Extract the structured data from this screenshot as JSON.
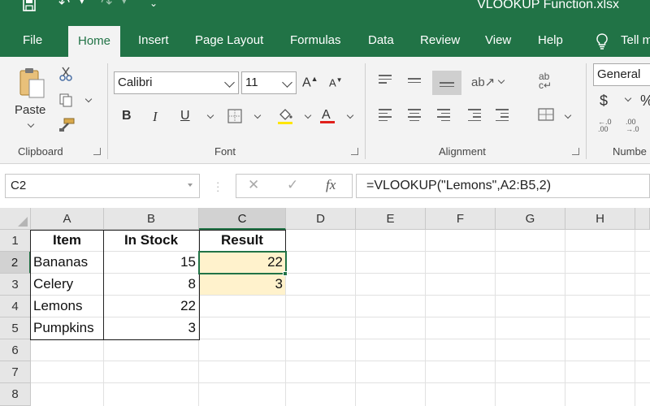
{
  "window": {
    "title": "VLOOKUP Function.xlsx"
  },
  "tabs": [
    {
      "label": "File",
      "active": false
    },
    {
      "label": "Home",
      "active": true
    },
    {
      "label": "Insert",
      "active": false
    },
    {
      "label": "Page Layout",
      "active": false
    },
    {
      "label": "Formulas",
      "active": false
    },
    {
      "label": "Data",
      "active": false
    },
    {
      "label": "Review",
      "active": false
    },
    {
      "label": "View",
      "active": false
    },
    {
      "label": "Help",
      "active": false
    },
    {
      "label": "Tell m",
      "active": false
    }
  ],
  "ribbon": {
    "clipboard": {
      "label": "Clipboard",
      "paste_label": "Paste"
    },
    "font": {
      "label": "Font",
      "font_name": "Calibri",
      "font_size": "11",
      "bold": "B",
      "italic": "I",
      "underline": "U"
    },
    "alignment": {
      "label": "Alignment"
    },
    "number": {
      "label": "Numbe",
      "format": "General",
      "currency": "$",
      "percent": "%"
    }
  },
  "formula_bar": {
    "name_box": "C2",
    "formula": "=VLOOKUP(\"Lemons\",A2:B5,2)",
    "fx": "fx"
  },
  "sheet": {
    "columns": [
      "A",
      "B",
      "C",
      "D",
      "E",
      "F",
      "G",
      "H"
    ],
    "rows": [
      "1",
      "2",
      "3",
      "4",
      "5",
      "6",
      "7",
      "8"
    ],
    "selected_cell": "C2",
    "cells": {
      "A1": "Item",
      "B1": "In Stock",
      "C1": "Result",
      "A2": "Bananas",
      "B2": "15",
      "C2": "22",
      "A3": "Celery",
      "B3": "8",
      "C3": "3",
      "A4": "Lemons",
      "B4": "22",
      "A5": "Pumpkins",
      "B5": "3"
    }
  },
  "colors": {
    "accent": "#217346",
    "highlight": "#fff2cc",
    "underline_red": "#e0201b"
  }
}
